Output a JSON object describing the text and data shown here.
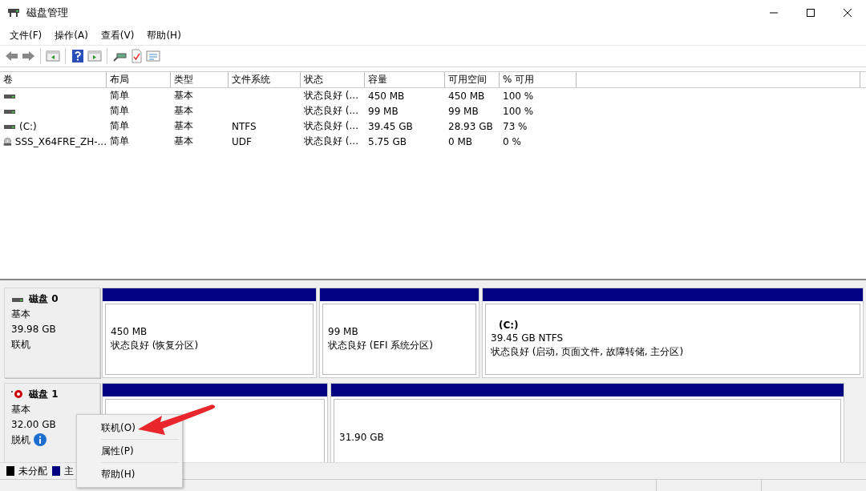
{
  "window": {
    "title": "磁盘管理"
  },
  "menu": [
    "文件(F)",
    "操作(A)",
    "查看(V)",
    "帮助(H)"
  ],
  "volume_table": {
    "columns": [
      "卷",
      "布局",
      "类型",
      "文件系统",
      "状态",
      "容量",
      "可用空间",
      "% 可用"
    ],
    "rows": [
      {
        "kind": "disk",
        "cells": [
          "",
          "简单",
          "基本",
          "",
          "状态良好 (...",
          "450 MB",
          "450 MB",
          "100 %"
        ]
      },
      {
        "kind": "disk",
        "cells": [
          "",
          "简单",
          "基本",
          "",
          "状态良好 (...",
          "99 MB",
          "99 MB",
          "100 %"
        ]
      },
      {
        "kind": "disk",
        "cells": [
          "(C:)",
          "简单",
          "基本",
          "NTFS",
          "状态良好 (...",
          "39.45 GB",
          "28.93 GB",
          "73 %"
        ]
      },
      {
        "kind": "cd",
        "cells": [
          "SSS_X64FRE_ZH-...",
          "简单",
          "基本",
          "UDF",
          "状态良好 (...",
          "5.75 GB",
          "0 MB",
          "0 %"
        ]
      }
    ]
  },
  "disks": [
    {
      "name": "磁盘 0",
      "type": "基本",
      "size": "39.98 GB",
      "status": "联机",
      "online": true,
      "partitions": [
        {
          "kind": "primary",
          "size": "450 MB",
          "status": "状态良好 (恢复分区)"
        },
        {
          "kind": "primary",
          "size": "99 MB",
          "status": "状态良好 (EFI 系统分区)"
        },
        {
          "kind": "primary",
          "label": "(C:)",
          "size": "39.45 GB NTFS",
          "status": "状态良好 (启动, 页面文件, 故障转储, 主分区)"
        }
      ]
    },
    {
      "name": "磁盘 1",
      "type": "基本",
      "size": "32.00 GB",
      "status": "脱机",
      "online": false,
      "partitions": [
        {
          "kind": "primary"
        },
        {
          "kind": "primary",
          "size": "31.90 GB"
        }
      ]
    }
  ],
  "legend": [
    {
      "label": "未分配",
      "color": "#000000"
    },
    {
      "label": "主",
      "color": "#000080"
    }
  ],
  "context_menu": [
    "联机(O)",
    "属性(P)",
    "帮助(H)"
  ],
  "annotations": [
    {
      "kind": "arrow"
    }
  ]
}
